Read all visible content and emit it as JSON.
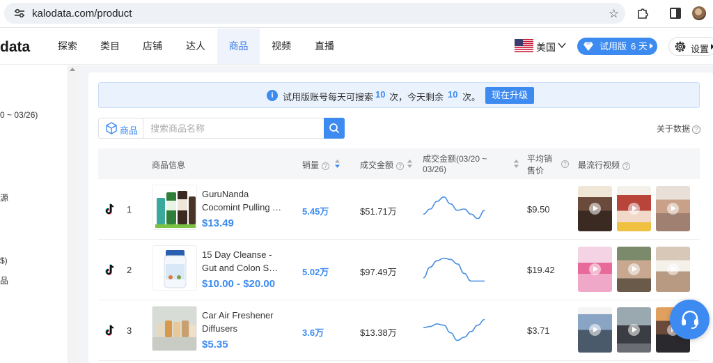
{
  "browser": {
    "url": "kalodata.com/product",
    "icons": [
      "site-info-icon",
      "star-icon",
      "extensions-icon",
      "side-panel-icon",
      "profile-avatar"
    ]
  },
  "nav": {
    "logo": "data",
    "items": [
      {
        "label": "探索"
      },
      {
        "label": "类目"
      },
      {
        "label": "店铺"
      },
      {
        "label": "达人"
      },
      {
        "label": "商品",
        "active": true
      },
      {
        "label": "视频"
      },
      {
        "label": "直播"
      }
    ],
    "country": "美国",
    "trial_label": "试用版",
    "trial_days": "6 天",
    "settings_label": "设置"
  },
  "sidebar": {
    "fragments": [
      "0 ~ 03/26)",
      "源",
      "$)",
      "品"
    ]
  },
  "notice": {
    "text1": "试用版账号每天可搜索",
    "count1": "10",
    "text2": "次，今天剩余",
    "count2": "10",
    "text3": "次。",
    "upgrade_label": "现在升级"
  },
  "search": {
    "type_label": "商品",
    "placeholder": "搜索商品名称",
    "about_data": "关于数据"
  },
  "table": {
    "headers": {
      "product_info": "商品信息",
      "sales": "销量",
      "gmv": "成交金额",
      "gmv_trend_line1": "成交金额(03/20 ~",
      "gmv_trend_line2": "03/26)",
      "avg_price_line1": "平均销",
      "avg_price_line2": "售价",
      "top_videos": "最流行视频"
    },
    "rows": [
      {
        "rank": "1",
        "name_line1": "GuruNanda",
        "name_line2": "Cocomint Pulling Oil",
        "price": "$13.49",
        "sales": "5.45万",
        "gmv": "$51.71万",
        "trend": [
          30,
          22,
          10,
          3,
          14,
          24,
          22,
          30,
          37,
          24
        ],
        "avg_price": "$9.50"
      },
      {
        "rank": "2",
        "name_line1": "15 Day Cleanse -",
        "name_line2": "Gut and Colon Support",
        "price": "$10.00 - $20.00",
        "sales": "5.02万",
        "gmv": "$97.49万",
        "trend": [
          35,
          18,
          8,
          4,
          6,
          13,
          28,
          40,
          40,
          40
        ],
        "avg_price": "$19.42"
      },
      {
        "rank": "3",
        "name_line1": "Car Air Freshener",
        "name_line2": "Diffusers",
        "price": "$5.35",
        "sales": "3.6万",
        "gmv": "$13.38万",
        "trend": [
          18,
          16,
          12,
          14,
          26,
          38,
          33,
          24,
          14,
          5
        ],
        "avg_price": "$3.71"
      }
    ]
  },
  "colors": {
    "accent": "#3d8bf0",
    "notice_bg": "#eaf3fd",
    "trend_line": "#4a90e2"
  }
}
